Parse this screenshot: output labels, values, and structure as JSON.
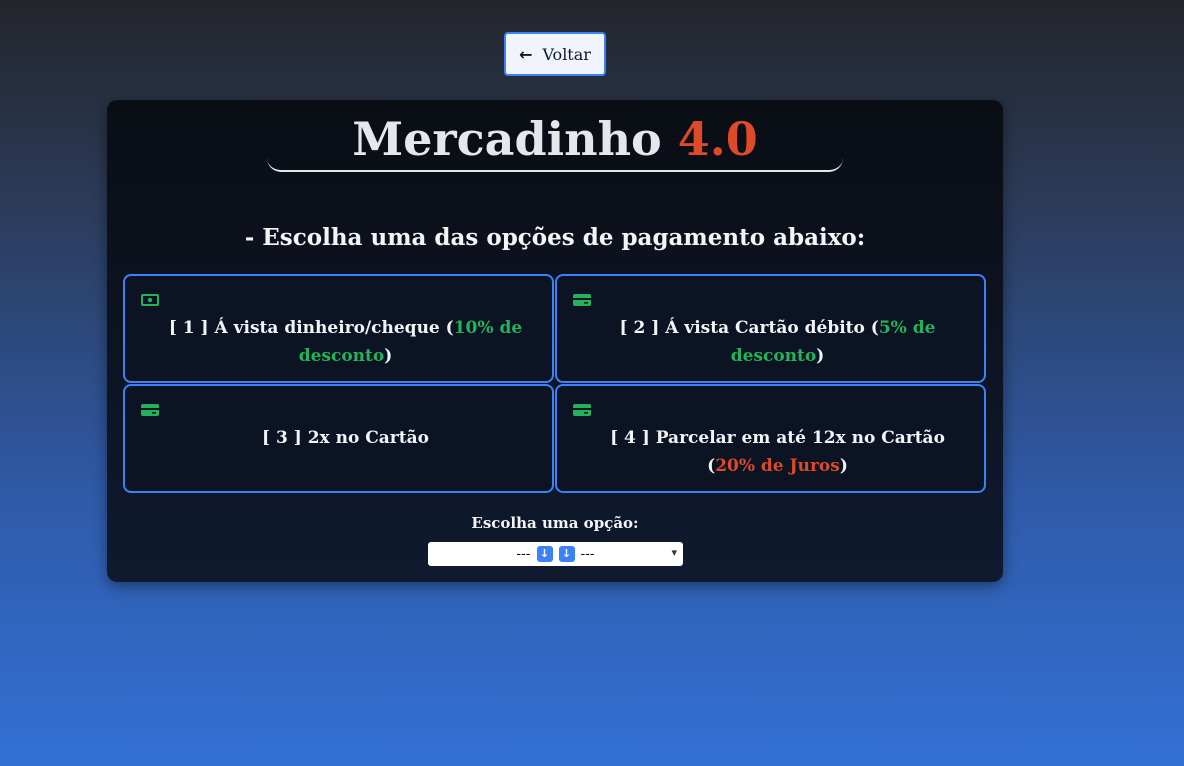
{
  "back_button": {
    "label": "Voltar",
    "icon": "arrow-left-icon"
  },
  "header": {
    "title_main": "Mercadinho",
    "title_version": "4.0"
  },
  "subtitle": "- Escolha uma das opções de pagamento abaixo:",
  "options": [
    {
      "icon": "money-bill-icon",
      "prefix": "[ 1 ] Á vista dinheiro/cheque (",
      "highlight": "10% de desconto",
      "suffix": ")",
      "highlight_color": "#22b35b"
    },
    {
      "icon": "credit-card-icon",
      "prefix": "[ 2 ] Á vista Cartão débito (",
      "highlight": "5% de desconto",
      "suffix": ")",
      "highlight_color": "#22b35b"
    },
    {
      "icon": "credit-card-icon",
      "prefix": "[ 3 ] 2x no Cartão",
      "highlight": "",
      "suffix": ""
    },
    {
      "icon": "credit-card-icon",
      "prefix": "[ 4 ] Parcelar em até 12x no Cartão (",
      "highlight": "20% de Juros",
      "suffix": ")",
      "highlight_color": "#dc4a2a"
    }
  ],
  "choose": {
    "label": "Escolha uma opção:",
    "selected_left": "---",
    "selected_right": "---"
  },
  "colors": {
    "accent": "#3b82f6",
    "discount": "#22b35b",
    "interest": "#dc4a2a"
  }
}
